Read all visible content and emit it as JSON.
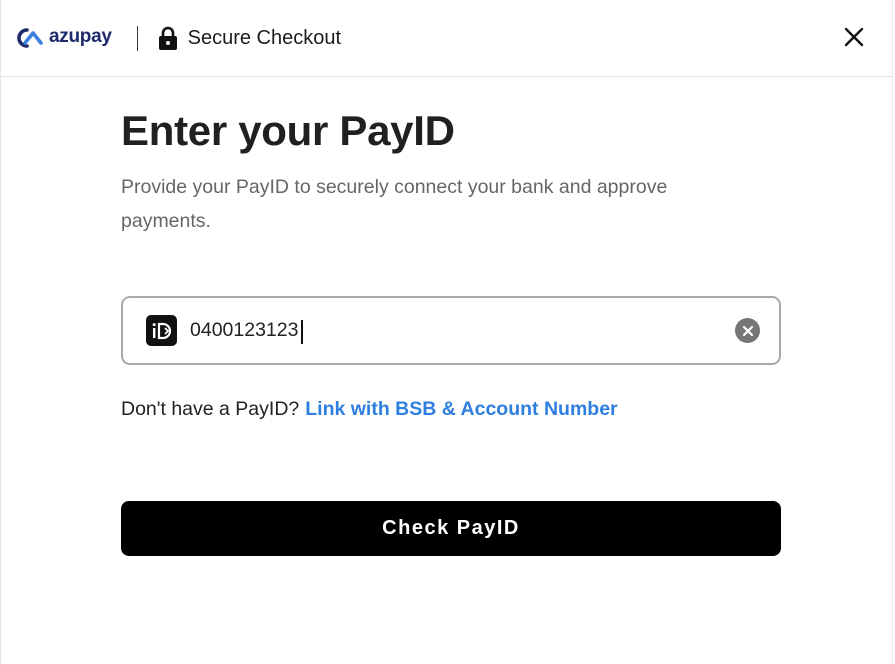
{
  "header": {
    "logo_text": "azupay",
    "title": "Secure Checkout"
  },
  "main": {
    "title": "Enter your PayID",
    "subtitle": "Provide your PayID to securely connect your bank and approve payments."
  },
  "payid_input": {
    "value": "0400123123",
    "icon": "payid-icon"
  },
  "helper": {
    "prompt": "Don't have a PayID?",
    "link": "Link with BSB & Account Number"
  },
  "actions": {
    "check_label": "Check PayID"
  },
  "colors": {
    "brand": "#1f2a6b",
    "link": "#2f7fe0",
    "button_bg": "#000000"
  }
}
